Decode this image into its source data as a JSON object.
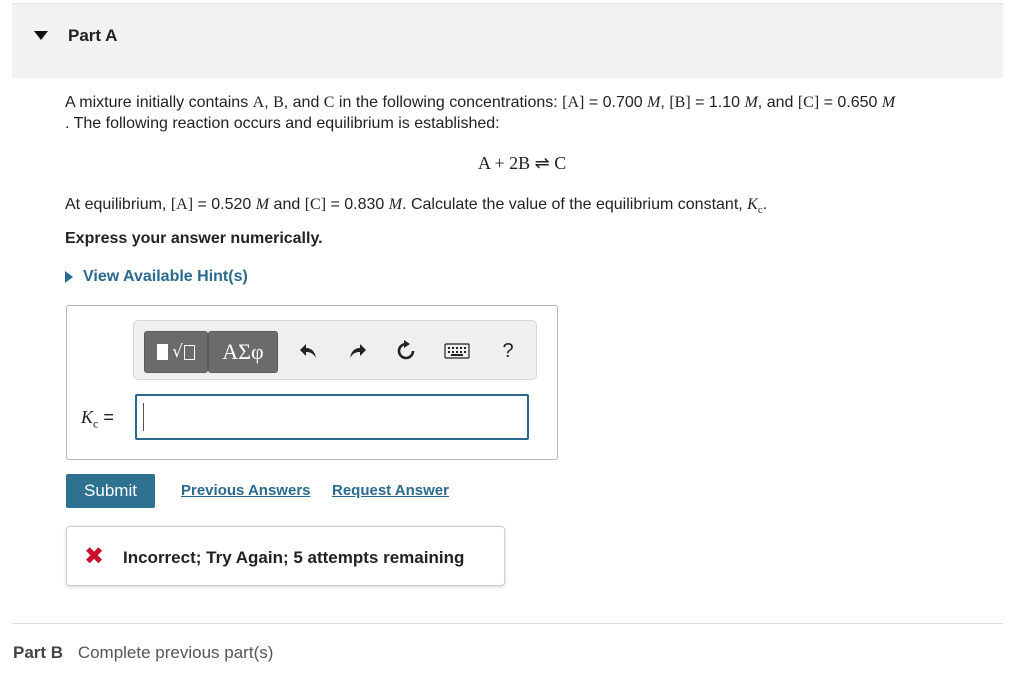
{
  "part_a": {
    "title": "Part A"
  },
  "problem": {
    "intro": "A mixture initially contains ",
    "sp_a": "A",
    "comma1": ", ",
    "sp_b": "B",
    "and1": ", and ",
    "sp_c": "C",
    "in_conc": " in the following concentrations: ",
    "ia": "[A]",
    "ia_val": " = 0.700 ",
    "unit": "M",
    "sep1": ", ",
    "ib": "[B]",
    "ib_val": " = 1.10 ",
    "sep2": ", and ",
    "ic": "[C]",
    "ic_val": " = 0.650 ",
    "line2": ". The following reaction occurs and equilibrium is established:",
    "equation": "A + 2B ⇌ C",
    "eq_intro": "At equilibrium, ",
    "ea": "[A]",
    "ea_val": " = 0.520 ",
    "and2": " and ",
    "ec": "[C]",
    "ec_val": " = 0.830 ",
    "calc": ". Calculate the value of the equilibrium constant, ",
    "kc_k": "K",
    "kc_sub": "c",
    "end": ".",
    "instruction": "Express your answer numerically."
  },
  "hint": {
    "label": "View Available Hint(s)"
  },
  "toolbar": {
    "greek_label": "ΑΣφ",
    "help_label": "?",
    "icons": [
      "templates-icon",
      "greek-icon",
      "undo-icon",
      "redo-icon",
      "reset-icon",
      "keyboard-icon",
      "help-icon"
    ]
  },
  "answer": {
    "label_k": "K",
    "label_sub": "c",
    "label_eq": " =",
    "value": ""
  },
  "actions": {
    "submit": "Submit",
    "previous_answers": "Previous Answers",
    "request_answer": "Request Answer"
  },
  "feedback": {
    "message": "Incorrect; Try Again; 5 attempts remaining",
    "status_color": "#c8102e"
  },
  "part_b": {
    "title": "Part B",
    "status": "Complete previous part(s)"
  },
  "colors": {
    "accent": "#2a6a8f",
    "submit_bg": "#2e7191",
    "header_bg": "#f2f2f2"
  }
}
